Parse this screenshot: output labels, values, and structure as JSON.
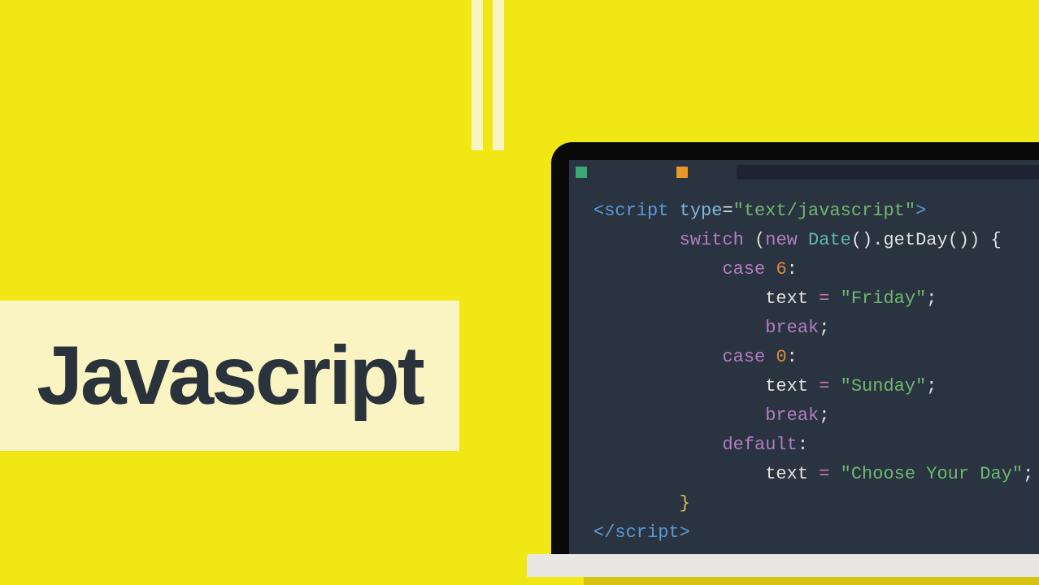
{
  "title": "Javascript",
  "code": {
    "line1_open": "<script",
    "line1_attr": " type",
    "line1_eq": "=",
    "line1_val": "\"text/javascript\"",
    "line1_close": ">",
    "line2_switch": "switch",
    "line2_paren": " (",
    "line2_new": "new",
    "line2_date": " Date",
    "line2_call": "().getDay()) {",
    "line3_case": "case",
    "line3_num": " 6",
    "line3_colon": ":",
    "line4_text": "text ",
    "line4_eq": "= ",
    "line4_val": "\"Friday\"",
    "line4_semi": ";",
    "line5_break": "break",
    "line5_semi": ";",
    "line6_case": "case",
    "line6_num": " 0",
    "line6_colon": ":",
    "line7_text": "text ",
    "line7_eq": "= ",
    "line7_val": "\"Sunday\"",
    "line7_semi": ";",
    "line8_break": "break",
    "line8_semi": ";",
    "line9_default": "default",
    "line9_colon": ":",
    "line10_text": "text ",
    "line10_eq": "= ",
    "line10_val": "\"Choose Your Day\"",
    "line10_semi": ";",
    "line11_brace": "}",
    "line12_close": "</script",
    "line12_gt": ">"
  }
}
